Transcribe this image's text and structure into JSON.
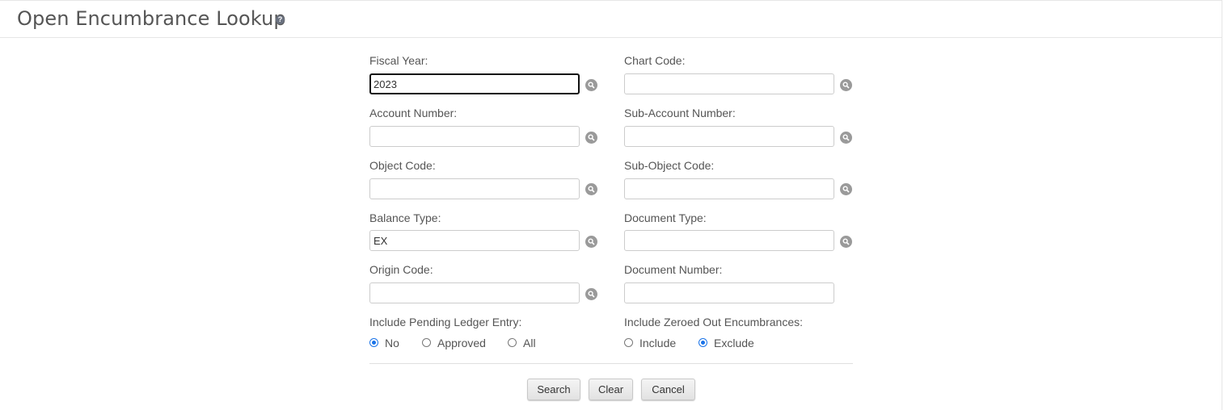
{
  "header": {
    "title": "Open Encumbrance Lookup"
  },
  "fields": {
    "fiscal_year": {
      "label": "Fiscal Year:",
      "value": "2023"
    },
    "chart_code": {
      "label": "Chart Code:",
      "value": ""
    },
    "account_number": {
      "label": "Account Number:",
      "value": ""
    },
    "sub_account_number": {
      "label": "Sub-Account Number:",
      "value": ""
    },
    "object_code": {
      "label": "Object Code:",
      "value": ""
    },
    "sub_object_code": {
      "label": "Sub-Object Code:",
      "value": ""
    },
    "balance_type": {
      "label": "Balance Type:",
      "value": "EX"
    },
    "document_type": {
      "label": "Document Type:",
      "value": ""
    },
    "origin_code": {
      "label": "Origin Code:",
      "value": ""
    },
    "document_number": {
      "label": "Document Number:",
      "value": ""
    }
  },
  "pending": {
    "label": "Include Pending Ledger Entry:",
    "options": [
      "No",
      "Approved",
      "All"
    ],
    "selected": "No"
  },
  "zeroed": {
    "label": "Include Zeroed Out Encumbrances:",
    "options": [
      "Include",
      "Exclude"
    ],
    "selected": "Exclude"
  },
  "buttons": {
    "search": "Search",
    "clear": "Clear",
    "cancel": "Cancel"
  },
  "icons": {
    "help": "help-icon",
    "lookup": "magnifier-lookup-icon"
  },
  "colors": {
    "radio_accent": "#1a73e8",
    "lookup_icon": "#9a9a9a"
  }
}
